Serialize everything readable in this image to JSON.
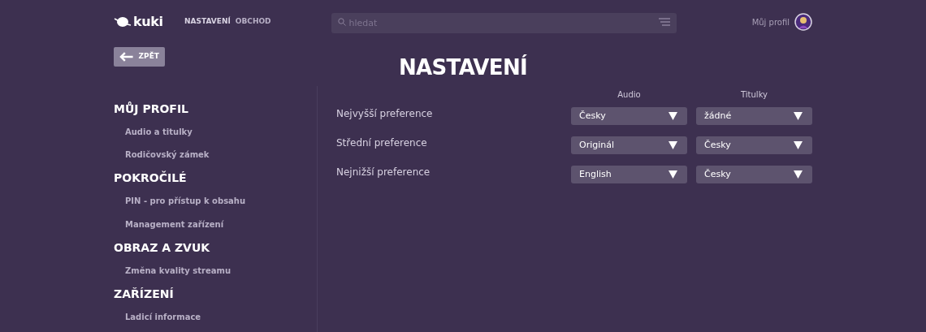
{
  "header": {
    "logo": "kuki",
    "nav": [
      {
        "label": "NASTAVENÍ",
        "selected": true
      },
      {
        "label": "OBCHOD",
        "selected": false
      }
    ],
    "search": {
      "placeholder": "hledat"
    },
    "profile": "Můj profil"
  },
  "back_button": "ZPĚT",
  "title": "NASTAVENÍ",
  "sidebar": [
    {
      "heading": "MŮJ PROFIL",
      "items": [
        "Audio a titulky",
        "Rodičovský zámek"
      ]
    },
    {
      "heading": "POKROČILÉ",
      "items": [
        "PIN - pro přístup k obsahu",
        "Management zařízení"
      ]
    },
    {
      "heading": "OBRAZ A ZVUK",
      "items": [
        "Změna kvality streamu"
      ]
    },
    {
      "heading": "ZAŘÍZENÍ",
      "items": [
        "Ladicí informace"
      ]
    }
  ],
  "preferences": {
    "columns": [
      "Audio",
      "Titulky"
    ],
    "rows": [
      {
        "label": "Nejvyšší preference",
        "audio": "Česky",
        "subtitles": "žádné"
      },
      {
        "label": "Střední preference",
        "audio": "Originál",
        "subtitles": "Česky"
      },
      {
        "label": "Nejnižší preference",
        "audio": "English",
        "subtitles": "Česky"
      }
    ]
  }
}
